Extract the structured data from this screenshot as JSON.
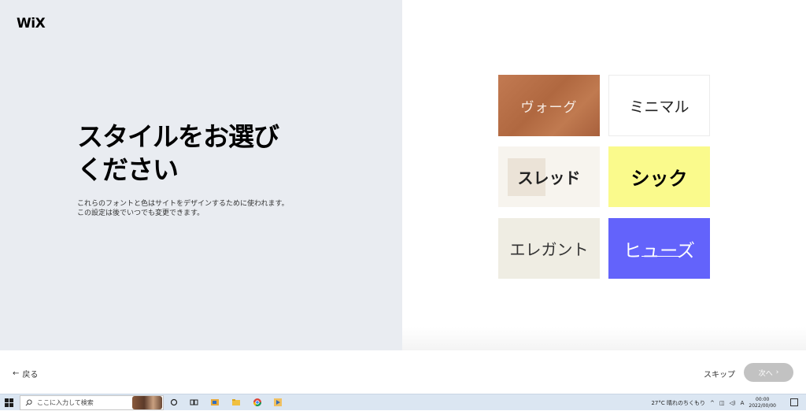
{
  "brand": {
    "logo": "WiX"
  },
  "intro": {
    "headline_line1": "スタイルをお選び",
    "headline_line2": "ください",
    "description_line1": "これらのフォントと色はサイトをデザインするために使われます。",
    "description_line2": "この設定は後でいつでも変更できます。"
  },
  "styles": [
    {
      "label": "ヴォーグ"
    },
    {
      "label": "ミニマル"
    },
    {
      "label": "スレッド"
    },
    {
      "label": "シック"
    },
    {
      "label": "エレガント"
    },
    {
      "label": "ヒューズ"
    }
  ],
  "colors": {
    "vogue": "#b8704a",
    "minimal": "#ffffff",
    "thread": "#f7f4ee",
    "chic": "#fafa8c",
    "elegant": "#efede3",
    "fuse": "#6363fb",
    "left_panel": "#e9ecf1",
    "next_button": "#c2c2c2"
  },
  "footer": {
    "back_label": "戻る",
    "skip_label": "スキップ",
    "next_label": "次へ"
  },
  "taskbar": {
    "search_placeholder": "ここに入力して検索",
    "weather": "27°C 晴れのちくもり",
    "time": "00:00",
    "date": "2022/00/00"
  },
  "icons": {
    "start": "windows-start-icon",
    "search": "magnifier-icon",
    "task_view": "task-view-icon",
    "chrome": "chrome-icon",
    "explorer": "folder-icon"
  }
}
